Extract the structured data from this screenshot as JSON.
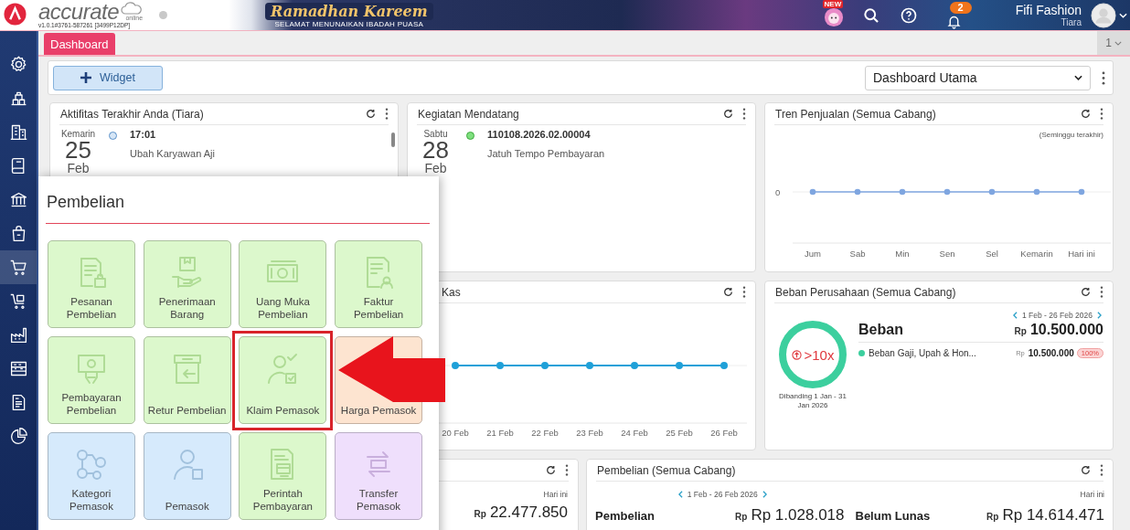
{
  "header": {
    "logo": "accurate",
    "logo_suffix": "online",
    "version": "v1.0.1#3761-587261 [3499P12DP]",
    "banner_title": "Ramadhan Kareem",
    "banner_subtitle": "SELAMAT MENUNAIKAN IBADAH PUASA",
    "new_badge": "NEW",
    "notification_count": "2",
    "company": "Fifi Fashion",
    "user": "Tiara"
  },
  "sidebar": {
    "items": [
      {
        "selected": false
      },
      {
        "selected": false
      },
      {
        "selected": false
      },
      {
        "selected": false
      },
      {
        "selected": false
      },
      {
        "selected": false
      },
      {
        "selected": true
      },
      {
        "selected": false
      },
      {
        "selected": false
      },
      {
        "selected": false
      },
      {
        "selected": false
      },
      {
        "selected": false
      }
    ]
  },
  "tabs": [
    {
      "label": "Dashboard",
      "selected": true
    }
  ],
  "page_selector": "1",
  "toolbar": {
    "widget_button": "Widget",
    "dashboard_select": "Dashboard Utama"
  },
  "activity_card": {
    "title": "Aktifitas Terakhir Anda (Tiara)",
    "entries": [
      {
        "day": "Kemarin",
        "date": "25",
        "month": "Feb",
        "time": "17:01",
        "description": "Ubah Karyawan Aji"
      }
    ]
  },
  "upcoming_card": {
    "title": "Kegiatan Mendatang",
    "entries": [
      {
        "day": "Sabtu",
        "date": "28",
        "month": "Feb",
        "number": "110108.2026.02.00004",
        "description": "Jatuh Tempo Pembayaran"
      }
    ]
  },
  "sales_trend_card": {
    "title": "Tren Penjualan (Semua Cabang)",
    "note": "(Seminggu terakhir)",
    "axis_label": "0",
    "day_labels": [
      "Jum",
      "Sab",
      "Min",
      "Sen",
      "Sel",
      "Kemarin",
      "Hari ini"
    ]
  },
  "cash_card": {
    "title": "Kas",
    "date_labels": [
      "20 Feb",
      "21 Feb",
      "22 Feb",
      "23 Feb",
      "24 Feb",
      "25 Feb",
      "26 Feb"
    ]
  },
  "expense_card": {
    "title": "Beban Perusahaan (Semua Cabang)",
    "period": "1 Feb - 26 Feb 2026",
    "comparison": ">10x",
    "comparison_note": "Dibanding 1 Jan - 31 Jan 2026",
    "label": "Beban",
    "currency": "Rp",
    "total": "10.500.000",
    "items": [
      {
        "name": "Beban Gaji, Upah & Hon...",
        "color": "#3ccf9e",
        "currency": "Rp",
        "amount": "10.500.000",
        "share": "100%"
      }
    ]
  },
  "balance_card": {
    "period": "Hari ini",
    "currency": "Rp",
    "amount": "22.477.850"
  },
  "purchase_card": {
    "title": "Pembelian (Semua Cabang)",
    "period": "1 Feb - 26 Feb 2026",
    "period_right": "Hari ini",
    "figures": [
      {
        "label": "Pembelian",
        "currency": "Rp",
        "amount": "Rp 1.028.018"
      },
      {
        "label": "Belum Lunas",
        "currency": "Rp",
        "amount": "Rp 14.614.471"
      }
    ]
  },
  "purchase_menu": {
    "title": "Pembelian",
    "tiles": [
      {
        "label": "Pesanan\nPembelian",
        "color": "#dcf8cc",
        "highlighted": false
      },
      {
        "label": "Penerimaan\nBarang",
        "color": "#dcf8cc",
        "highlighted": false
      },
      {
        "label": "Uang Muka\nPembelian",
        "color": "#dcf8cc",
        "highlighted": false
      },
      {
        "label": "Faktur\nPembelian",
        "color": "#dcf8cc",
        "highlighted": false
      },
      {
        "label": "Pembayaran\nPembelian",
        "color": "#dcf8cc",
        "highlighted": false
      },
      {
        "label": "Retur Pembelian",
        "color": "#dcf8cc",
        "highlighted": false
      },
      {
        "label": "Klaim Pemasok",
        "color": "#dcf8cc",
        "highlighted": true
      },
      {
        "label": "Harga Pemasok",
        "color": "#fde4d0",
        "highlighted": false
      },
      {
        "label": "Kategori\nPemasok",
        "color": "#d6eafc",
        "highlighted": false
      },
      {
        "label": "Pemasok",
        "color": "#d6eafc",
        "highlighted": false
      },
      {
        "label": "Perintah\nPembayaran",
        "color": "#dcf8cc",
        "highlighted": false
      },
      {
        "label": "Transfer\nPemasok",
        "color": "#efdffc",
        "highlighted": false
      }
    ]
  }
}
